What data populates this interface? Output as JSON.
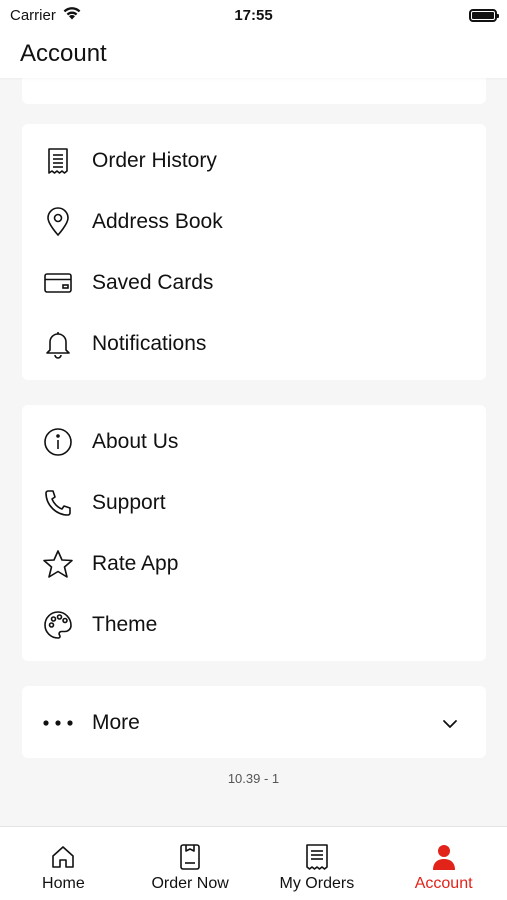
{
  "status_bar": {
    "carrier": "Carrier",
    "time": "17:55"
  },
  "header": {
    "title": "Account"
  },
  "menu_group_1": [
    {
      "label": "Order History",
      "icon": "receipt-icon"
    },
    {
      "label": "Address Book",
      "icon": "location-pin-icon"
    },
    {
      "label": "Saved Cards",
      "icon": "credit-card-icon"
    },
    {
      "label": "Notifications",
      "icon": "bell-icon"
    }
  ],
  "menu_group_2": [
    {
      "label": "About Us",
      "icon": "info-icon"
    },
    {
      "label": "Support",
      "icon": "phone-icon"
    },
    {
      "label": "Rate App",
      "icon": "star-icon"
    },
    {
      "label": "Theme",
      "icon": "palette-icon"
    }
  ],
  "more": {
    "label": "More",
    "icon": "more-dots-icon"
  },
  "version": "10.39 - 1",
  "tabs": [
    {
      "label": "Home",
      "icon": "home-icon"
    },
    {
      "label": "Order Now",
      "icon": "order-now-icon"
    },
    {
      "label": "My Orders",
      "icon": "orders-list-icon"
    },
    {
      "label": "Account",
      "icon": "person-icon",
      "active": true
    }
  ],
  "colors": {
    "accent": "#e2231a",
    "background": "#f6f6f6",
    "card": "#ffffff"
  }
}
